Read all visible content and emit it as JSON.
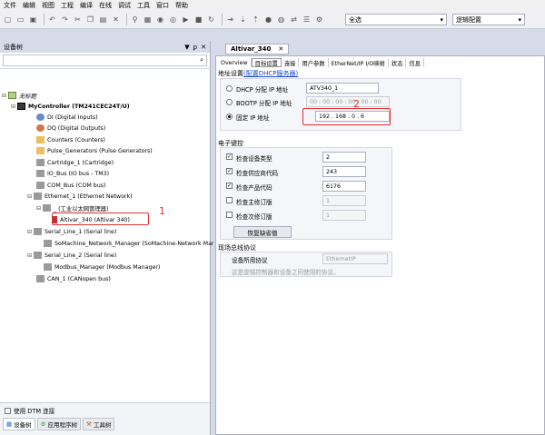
{
  "menu": [
    "文件",
    "编辑",
    "视图",
    "工程",
    "编译",
    "在线",
    "调试",
    "工具",
    "窗口",
    "帮助"
  ],
  "toolbar": {
    "scope_combo": "全选",
    "logic_combo": "逻辑配置"
  },
  "device_tree": {
    "title": "设备树",
    "controls": [
      "▼",
      "ꝑ",
      "✕"
    ],
    "nodes": [
      {
        "label": "无标题",
        "level": 0
      },
      {
        "label": "MyController (TM241CEC24T/U)",
        "level": 1
      },
      {
        "label": "DI (Digital Inputs)",
        "level": 2
      },
      {
        "label": "DQ (Digital Outputs)",
        "level": 2
      },
      {
        "label": "Counters (Counters)",
        "level": 2
      },
      {
        "label": "Pulse_Generators (Pulse Generators)",
        "level": 2
      },
      {
        "label": "Cartridge_1 (Cartridge)",
        "level": 2
      },
      {
        "label": "IO_Bus (IO bus - TM3)",
        "level": 2
      },
      {
        "label": "COM_Bus (COM bus)",
        "level": 2
      },
      {
        "label": "Ethernet_1 (Ethernet Network)",
        "level": 2
      },
      {
        "label": "_ (工业以太网管理器)",
        "level": 3
      },
      {
        "label": "Altivar_340 (Altivar 340)",
        "level": 4
      },
      {
        "label": "Serial_Line_1 (Serial line)",
        "level": 2
      },
      {
        "label": "SoMachine_Network_Manager (SoMachine-Network Manag",
        "level": 3
      },
      {
        "label": "Serial_Line_2 (Serial line)",
        "level": 2
      },
      {
        "label": "Modbus_Manager (Modbus Manager)",
        "level": 3
      },
      {
        "label": "CAN_1 (CANopen bus)",
        "level": 2
      }
    ],
    "annotation_1": "1",
    "dtm_label": "使用 DTM 连接",
    "bottom_tabs": [
      "设备树",
      "应用程序树",
      "工具树"
    ]
  },
  "editor": {
    "doc_tab": "Altivar_340",
    "doc_close": "✕",
    "subtabs": [
      "Overview",
      "目标设置",
      "连接",
      "用户参数",
      "EtherNet/IP I/O映射",
      "状态",
      "信息"
    ],
    "addr_section": "地址设置",
    "addr_link": "(配置DHCP服务器)",
    "dhcp_label": "DHCP 分配 IP 地址",
    "dhcp_value": "ATV340_1",
    "bootp_label": "BOOTP 分配 IP 地址",
    "bootp_value": "00 : 00 : 00 : 00 : 00 : 00",
    "fixed_label": "固定 IP 地址",
    "ip_value": "192  .  168  .   0   .   6",
    "annotation_2": "2",
    "ekey_section": "电子键控",
    "checks": [
      {
        "label": "检查设备类型",
        "value": "2",
        "checked": true
      },
      {
        "label": "检查供应商代码",
        "value": "243",
        "checked": true
      },
      {
        "label": "检查产品代码",
        "value": "6176",
        "checked": true
      },
      {
        "label": "检查主修订版",
        "value": "1",
        "checked": false
      },
      {
        "label": "检查次修订版",
        "value": "1",
        "checked": false
      }
    ],
    "restore_button": "恢复缺省值",
    "fieldbus_section": "现场总线协议",
    "protocol_label": "设备所用协议",
    "protocol_value": "EthernetIP",
    "protocol_note": "这是逻辑控制器和设备之间使用的协议。"
  }
}
